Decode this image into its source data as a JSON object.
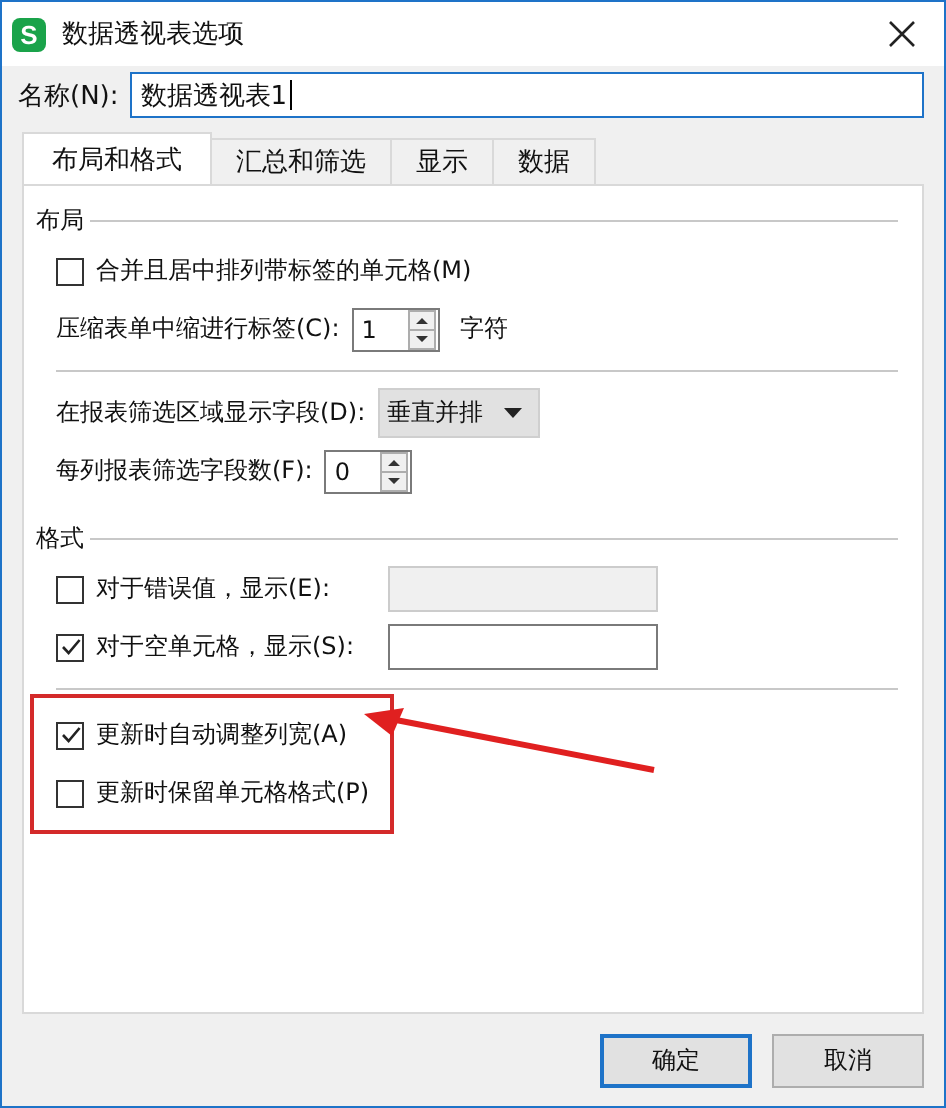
{
  "window": {
    "title": "数据透视表选项",
    "app_icon_letter": "S"
  },
  "name_field": {
    "label": "名称(N):",
    "value": "数据透视表1"
  },
  "tabs": [
    {
      "label": "布局和格式",
      "selected": true
    },
    {
      "label": "汇总和筛选",
      "selected": false
    },
    {
      "label": "显示",
      "selected": false
    },
    {
      "label": "数据",
      "selected": false
    }
  ],
  "sections": [
    {
      "title": "布局",
      "groups": [
        {
          "highlighted": false,
          "items": [
            {
              "kind": "checkbox",
              "label": "合并且居中排列带标签的单元格(M)",
              "checked": false
            },
            {
              "kind": "spinner",
              "label": "压缩表单中缩进行标签(C):",
              "value": "1",
              "suffix": "字符"
            }
          ]
        },
        {
          "highlighted": false,
          "items": [
            {
              "kind": "dropdown",
              "label": "在报表筛选区域显示字段(D):",
              "value": "垂直并排"
            },
            {
              "kind": "spinner",
              "label": "每列报表筛选字段数(F):",
              "value": "0"
            }
          ]
        }
      ]
    },
    {
      "title": "格式",
      "groups": [
        {
          "highlighted": false,
          "items": [
            {
              "kind": "checkbox",
              "label": "对于错误值，显示(E):",
              "checked": false,
              "field": {
                "disabled": true
              }
            },
            {
              "kind": "checkbox",
              "label": "对于空单元格，显示(S):",
              "checked": true,
              "field": {
                "disabled": false
              }
            }
          ]
        },
        {
          "highlighted": true,
          "items": [
            {
              "kind": "checkbox",
              "label": "更新时自动调整列宽(A)",
              "checked": true
            },
            {
              "kind": "checkbox",
              "label": "更新时保留单元格格式(P)",
              "checked": false
            }
          ]
        }
      ]
    }
  ],
  "buttons": [
    {
      "label": "确定",
      "default": true
    },
    {
      "label": "取消",
      "default": false
    }
  ]
}
